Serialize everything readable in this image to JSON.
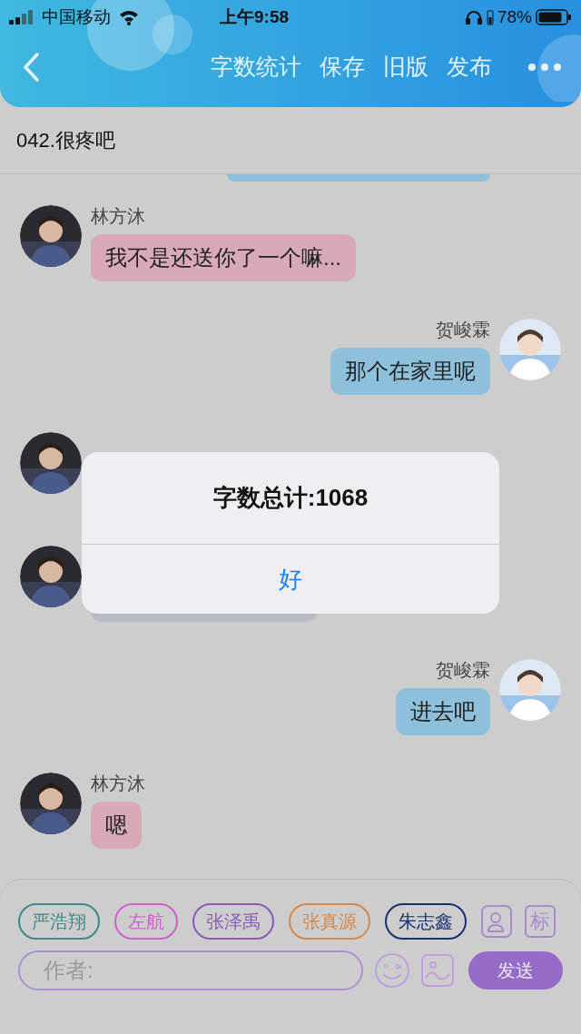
{
  "status_bar": {
    "carrier": "中国移动",
    "time": "上午9:58",
    "battery": "78%"
  },
  "nav": {
    "actions": [
      "字数统计",
      "保存",
      "旧版",
      "发布"
    ]
  },
  "title": "042.很疼吧",
  "messages": [
    {
      "kind": "outgoing-partial",
      "color": "#8ec0dc"
    },
    {
      "kind": "incoming",
      "name": "林方沐",
      "text": "我不是还送你了一个嘛...",
      "color": "#d8aab6"
    },
    {
      "kind": "outgoing",
      "name": "贺峻霖",
      "text": "那个在家里呢",
      "color": "#8ec0dc"
    },
    {
      "kind": "incoming"
    },
    {
      "kind": "incoming",
      "color": "#b8bcc4"
    },
    {
      "kind": "outgoing",
      "name": "贺峻霖",
      "text": "进去吧",
      "color": "#8ec0dc"
    },
    {
      "kind": "incoming",
      "name": "林方沐",
      "text": "嗯",
      "color": "#d8aab6"
    }
  ],
  "chips": [
    {
      "label": "严浩翔",
      "color": "#3d8a8c"
    },
    {
      "label": "左航",
      "color": "#d060d0"
    },
    {
      "label": "张泽禹",
      "color": "#8a5cb8"
    },
    {
      "label": "张真源",
      "color": "#d88848"
    },
    {
      "label": "朱志鑫",
      "color": "#1a3070"
    }
  ],
  "tag_button": "标",
  "author_field": {
    "placeholder": "作者:"
  },
  "send_button": "发送",
  "alert": {
    "message": "字数总计:1068",
    "button": "好"
  }
}
